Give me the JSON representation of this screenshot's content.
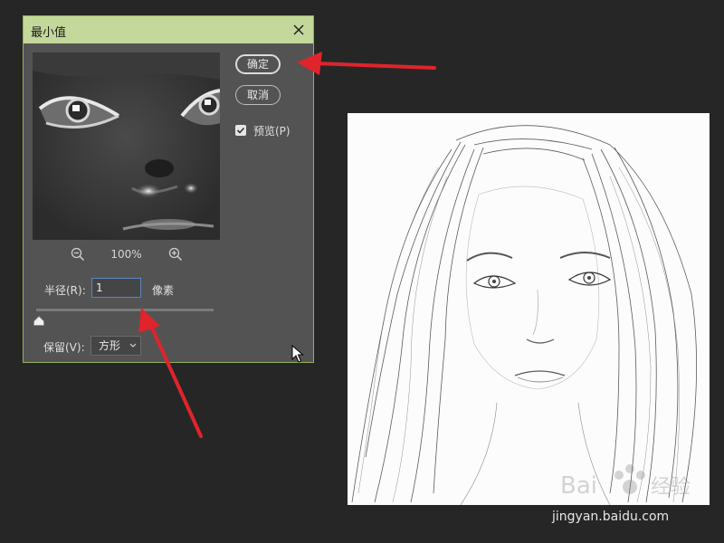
{
  "dialog": {
    "title": "最小值",
    "ok_label": "确定",
    "cancel_label": "取消",
    "preview_label": "预览(P)",
    "preview_checked": true,
    "zoom_level": "100%",
    "radius_label": "半径(R):",
    "radius_value": "1",
    "radius_unit": "像素",
    "slider_value": 1,
    "preserve_label": "保留(V):",
    "preserve_selected": "方形"
  },
  "watermark": {
    "url_text": "jingyan.baidu.com",
    "logo_text": "Baidu 经验"
  },
  "colors": {
    "accent_arrow": "#e0242b",
    "titlebar": "#c3d89a",
    "dialog_bg": "#535353",
    "page_bg": "#262626"
  },
  "icons": [
    "close-icon",
    "zoom-out-icon",
    "zoom-in-icon",
    "checkmark-icon",
    "chevron-down-icon",
    "slider-thumb-icon",
    "mouse-cursor-icon",
    "red-arrow-icon"
  ]
}
